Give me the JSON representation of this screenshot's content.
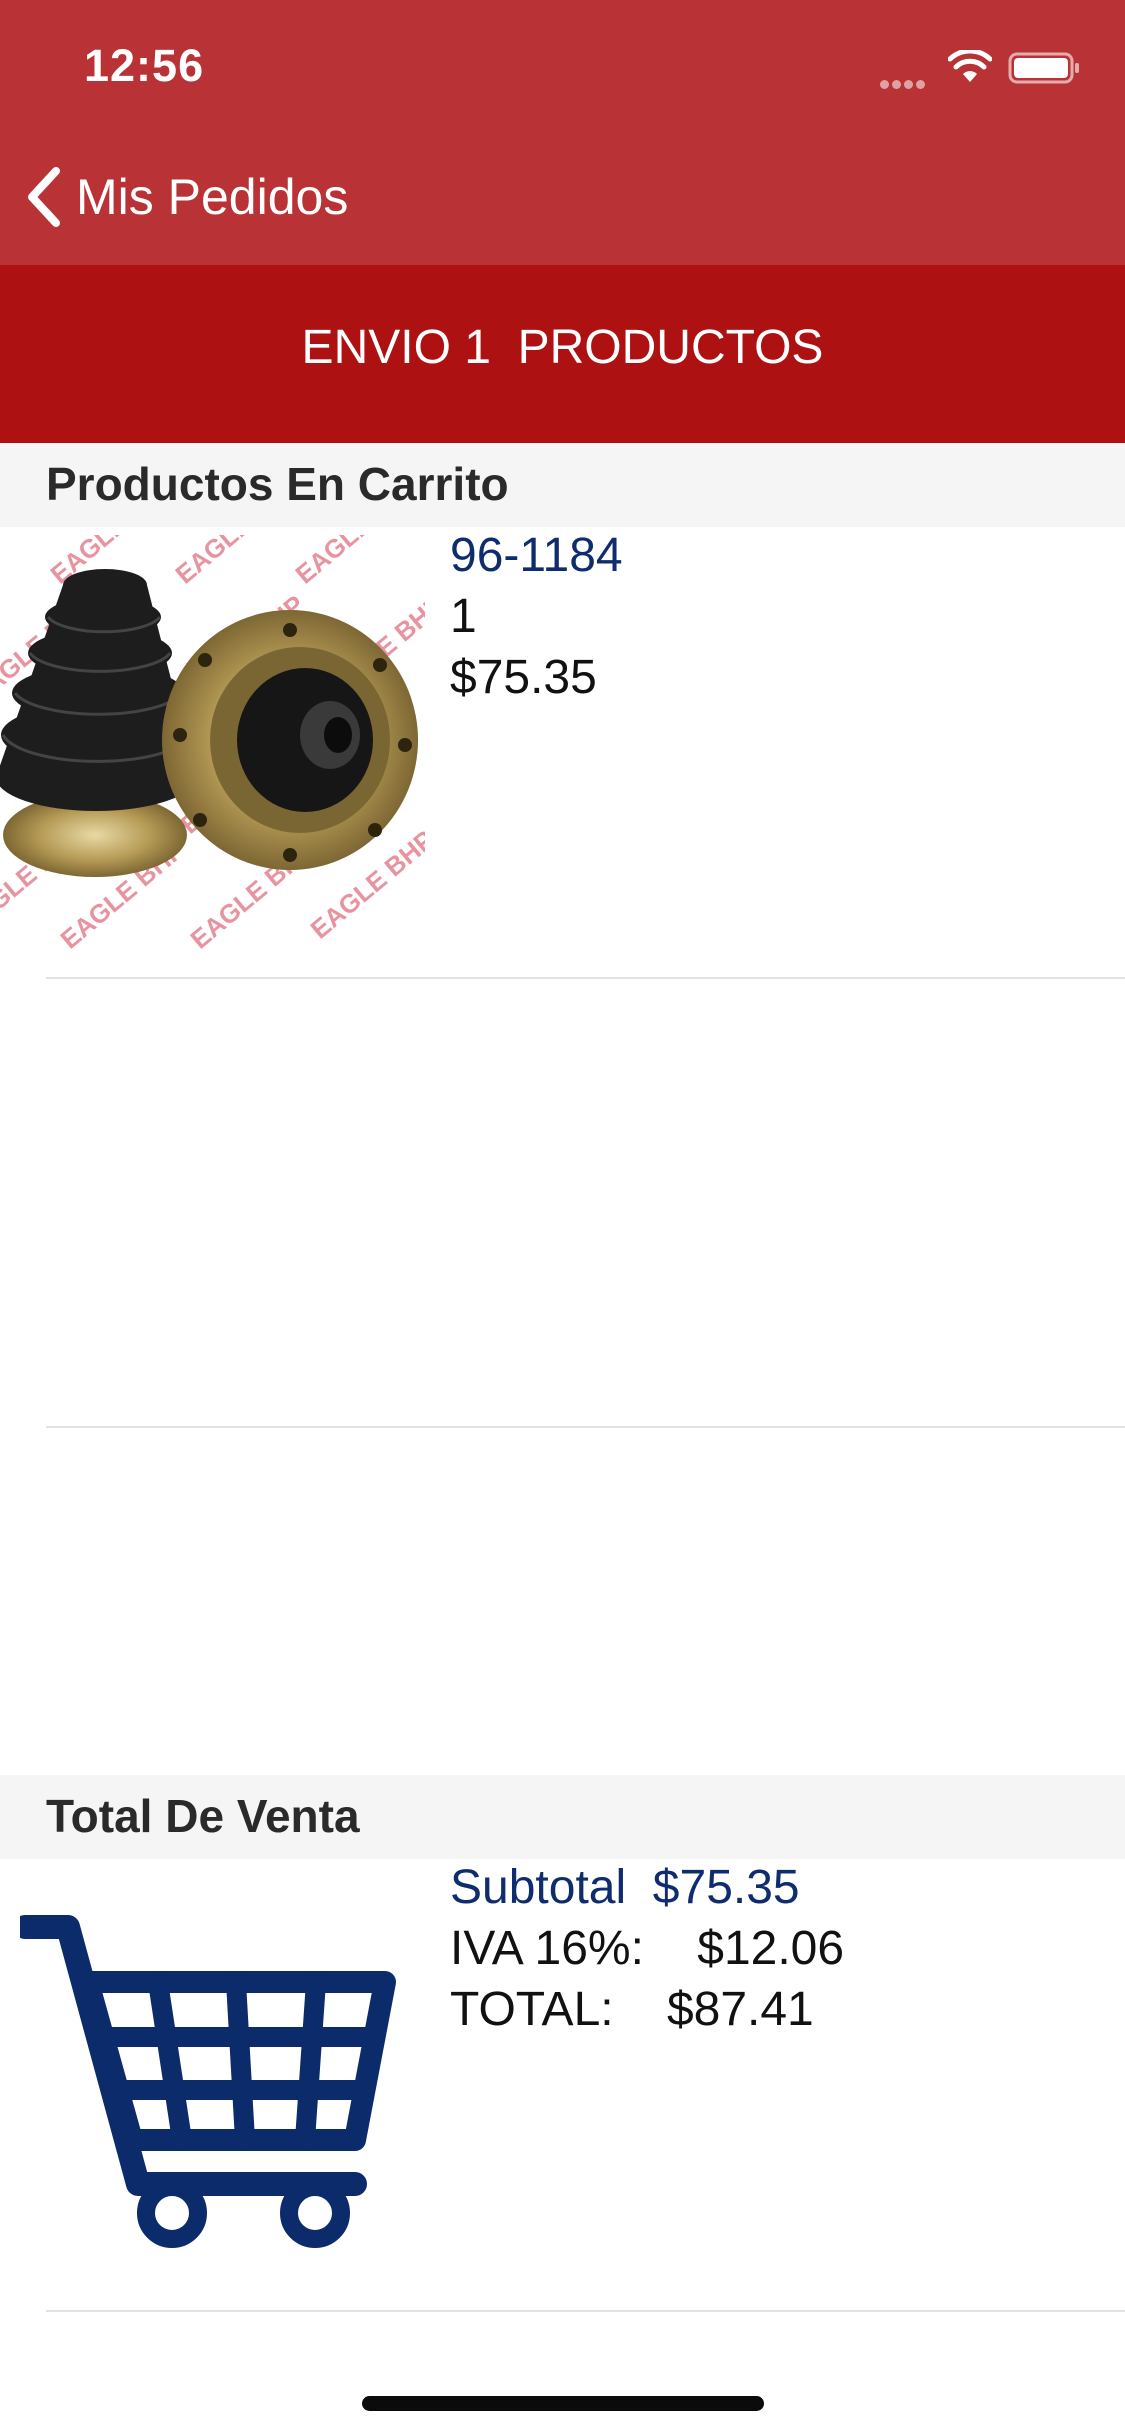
{
  "status_bar": {
    "time": "12:56"
  },
  "nav": {
    "back_label": "Mis Pedidos"
  },
  "banner": {
    "label": "ENVIO 1  PRODUCTOS"
  },
  "cart_section": {
    "header": "Productos En Carrito",
    "items": [
      {
        "code": "96-1184",
        "quantity": "1",
        "price": "$75.35"
      }
    ],
    "watermark": "EAGLE BHP"
  },
  "totals_section": {
    "header": "Total De Venta",
    "subtotal": "Subtotal  $75.35",
    "tax": "IVA 16%:    $12.06",
    "total": "TOTAL:    $87.41"
  },
  "colors": {
    "nav_red": "#b83236",
    "banner_red": "#ad1112",
    "accent_blue": "#0e2c6e"
  },
  "icons": [
    "chevron-left-icon",
    "wifi-icon",
    "battery-icon",
    "cart-icon"
  ]
}
